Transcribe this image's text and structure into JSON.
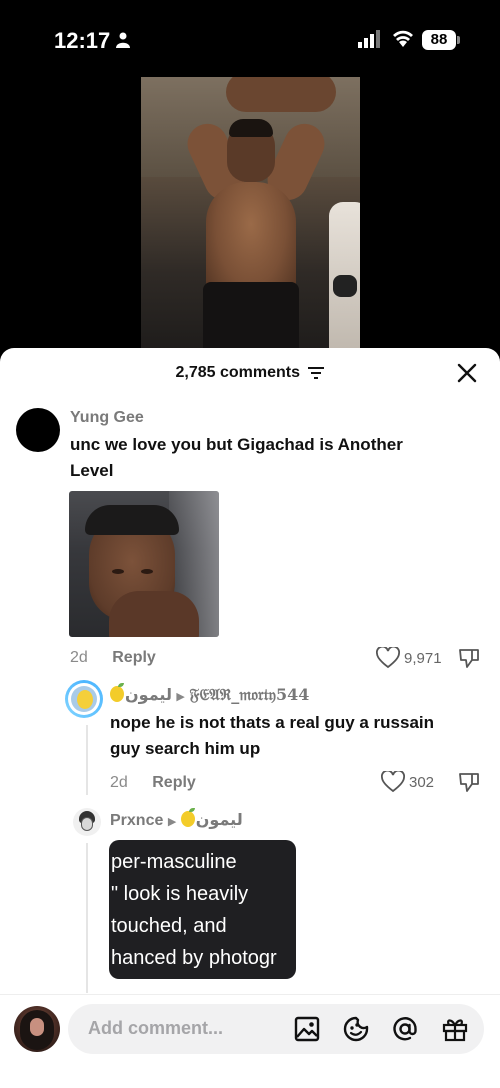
{
  "status_bar": {
    "time": "12:17",
    "battery": "88"
  },
  "sheet": {
    "title": "2,785 comments"
  },
  "comments": [
    {
      "username": "Yung Gee",
      "text_line1": "unc we love you but Gigachad is Another",
      "text_line2": "Level",
      "age": "2d",
      "reply_label": "Reply",
      "likes": "9,971"
    },
    {
      "username": "ليمون",
      "reply_to": "𝔉𝔈𝔄ℜ_𝔪𝔬𝔯𝔱𝔶544",
      "text_line1": "nope he is not thats a real guy a russain",
      "text_line2": "guy search him up",
      "age": "2d",
      "reply_label": "Reply",
      "likes": "302"
    },
    {
      "username": "Prxnce",
      "reply_to": "ليمون"
    }
  ],
  "tooltip_lines": [
    "per-masculine",
    "\" look is heavily",
    "touched, and",
    "hanced by photogr"
  ],
  "composer": {
    "placeholder": "Add comment..."
  },
  "icons": [
    "person-icon",
    "signal-icon",
    "wifi-icon",
    "filter-icon",
    "close-icon",
    "heart-icon",
    "dislike-icon",
    "image-icon",
    "emoji-icon",
    "mention-icon",
    "gift-icon"
  ]
}
